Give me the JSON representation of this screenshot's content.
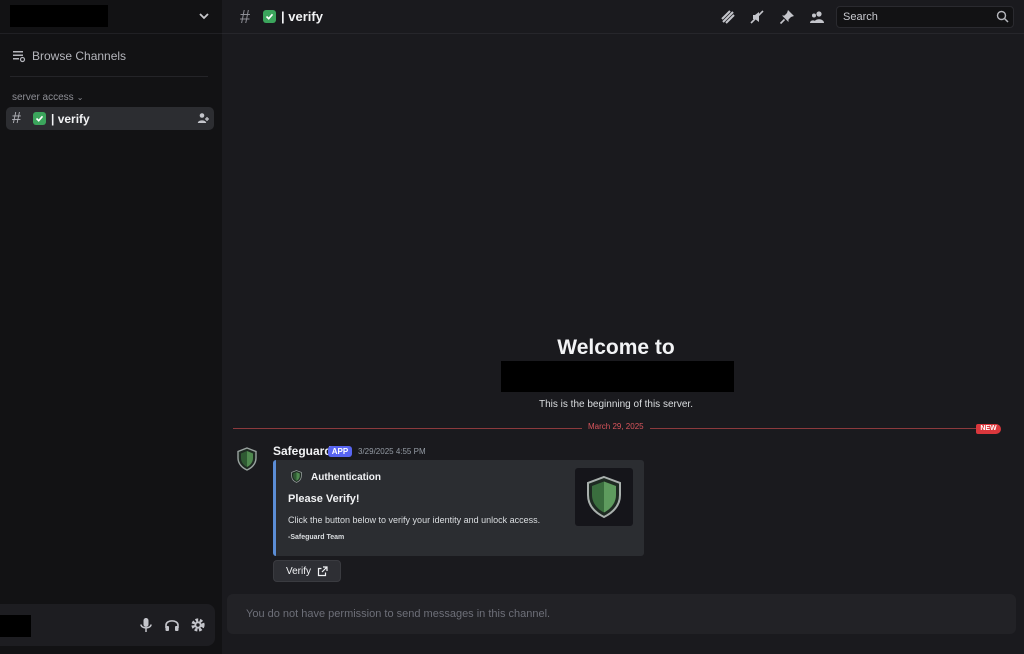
{
  "sidebar": {
    "browse_label": "Browse Channels",
    "category_label": "server access",
    "channel": {
      "name": "| verify",
      "prefix": "#"
    }
  },
  "header": {
    "channel_title": "| verify",
    "search_placeholder": "Search"
  },
  "welcome": {
    "title": "Welcome to",
    "subtitle": "This is the beginning of this server."
  },
  "divider": {
    "date": "March 29, 2025",
    "badge": "NEW"
  },
  "message": {
    "author": "Safeguard",
    "tag": "APP",
    "timestamp": "3/29/2025 4:55 PM",
    "embed": {
      "author": "Authentication",
      "title": "Please Verify!",
      "description": "Click the button below to verify your identity and unlock access.",
      "footer": "-Safeguard Team",
      "accent_color": "#5b8dd6"
    },
    "button_label": "Verify"
  },
  "composer": {
    "placeholder": "You do not have permission to send messages in this channel."
  },
  "colors": {
    "checkmark": "#3ba55c",
    "app_tag": "#5865f2",
    "new_badge": "#da373c",
    "shield": "#4f8a4f"
  },
  "icons": [
    "chevron-down-icon",
    "browse-channels-icon",
    "add-member-icon",
    "threads-icon",
    "mute-icon",
    "pin-icon",
    "members-icon",
    "search-icon",
    "mic-icon",
    "headphones-icon",
    "settings-icon",
    "external-link-icon",
    "shield-icon"
  ]
}
